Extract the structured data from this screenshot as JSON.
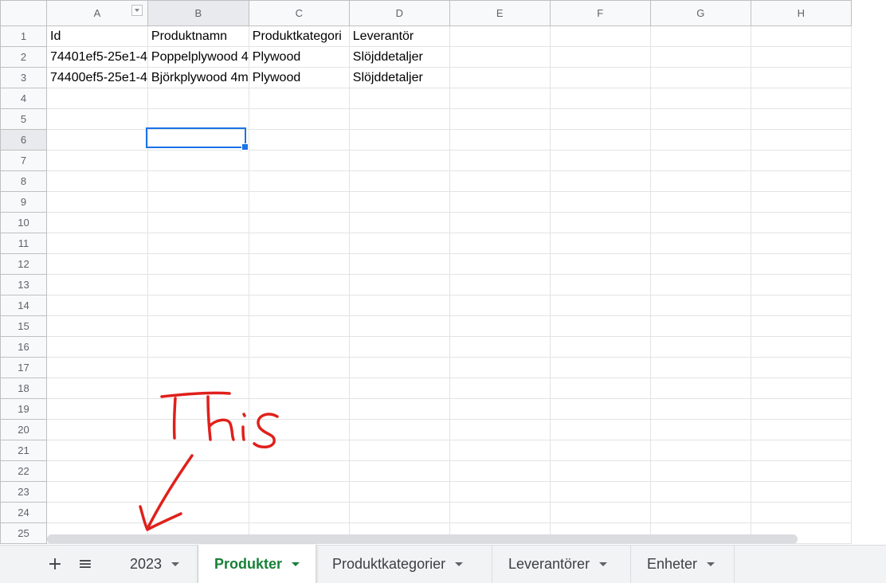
{
  "columns": [
    "A",
    "B",
    "C",
    "D",
    "E",
    "F",
    "G",
    "H"
  ],
  "rows": [
    "1",
    "2",
    "3",
    "4",
    "5",
    "6",
    "7",
    "8",
    "9",
    "10",
    "11",
    "12",
    "13",
    "14",
    "15",
    "16",
    "17",
    "18",
    "19",
    "20",
    "21",
    "22",
    "23",
    "24",
    "25"
  ],
  "cells": {
    "r1": [
      "Id",
      "Produktnamn",
      "Produktkategori",
      "Leverantör"
    ],
    "r2": [
      "74401ef5-25e1-4",
      "Poppelplywood 4",
      "Plywood",
      "Slöjddetaljer"
    ],
    "r3": [
      "74400ef5-25e1-4",
      "Björkplywood 4m",
      "Plywood",
      "Slöjddetaljer"
    ]
  },
  "selection": {
    "column": "B",
    "row": "6"
  },
  "tabs": {
    "add_icon": "+",
    "menu_icon": "≡",
    "items": [
      {
        "label": "2023",
        "active": false
      },
      {
        "label": "Produkter",
        "active": true
      },
      {
        "label": "Produktkategorier",
        "active": false
      },
      {
        "label": "Leverantörer",
        "active": false
      },
      {
        "label": "Enheter",
        "active": false
      }
    ]
  },
  "annotation": {
    "text": "This",
    "color": "#e0201b"
  },
  "colors": {
    "accent": "#1a73e8",
    "active_tab": "#188038"
  }
}
